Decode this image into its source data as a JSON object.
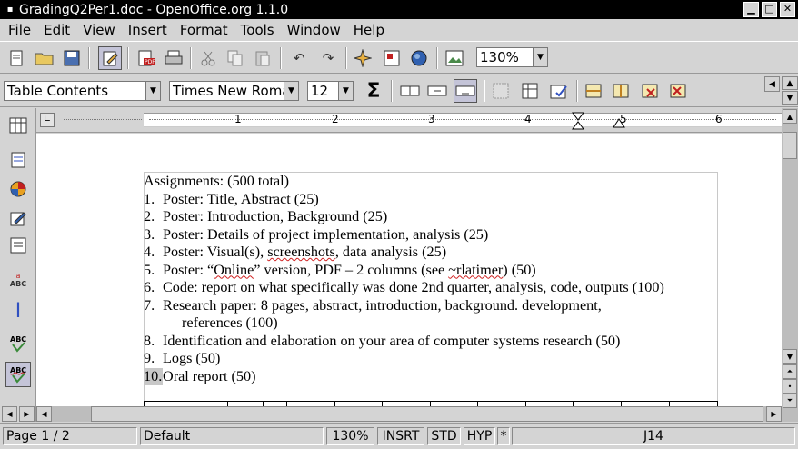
{
  "window": {
    "title": "GradingQ2Per1.doc - OpenOffice.org 1.1.0",
    "buttons": {
      "minimize": "▁",
      "maximize": "□",
      "close": "✕"
    }
  },
  "menu": [
    "File",
    "Edit",
    "View",
    "Insert",
    "Format",
    "Tools",
    "Window",
    "Help"
  ],
  "toolbar": {
    "zoom": "130%",
    "paragraph_style": "Table Contents",
    "font_name": "Times New Roma",
    "font_size": "12",
    "sum_symbol": "Σ"
  },
  "ruler": {
    "numbers": [
      "1",
      "2",
      "3",
      "4",
      "5",
      "6"
    ]
  },
  "document": {
    "heading": "Assignments: (500 total)",
    "items": [
      {
        "num": "1.",
        "text": "Poster: Title, Abstract (25)"
      },
      {
        "num": "2.",
        "text": "Poster: Introduction, Background (25)"
      },
      {
        "num": "3.",
        "text": "Poster: Details of project implementation, analysis (25)"
      },
      {
        "num": "4.",
        "pre": "Poster: Visual(s), ",
        "wavy": "screenshots",
        "post": ", data analysis (25)"
      },
      {
        "num": "5.",
        "pre": "Poster: “",
        "wavy": "Online",
        "post": "” version, PDF – 2 columns (see ",
        "wavy2": "~rlatimer",
        "post2": ") (50)"
      },
      {
        "num": "6.",
        "text": "Code: report on what specifically was done 2nd quarter, analysis, code, outputs (100)"
      },
      {
        "num": "7.",
        "text": "Research paper: 8 pages, abstract, introduction, background. development,",
        "cont": "references (100)"
      },
      {
        "num": "8.",
        "text": "Identification and elaboration on your area of computer systems research (50)"
      },
      {
        "num": "9.",
        "text": "Logs (50)"
      },
      {
        "num": "10.",
        "text": "Oral report (50)"
      }
    ]
  },
  "status": {
    "page": "Page 1 / 2",
    "style": "Default",
    "zoom": "130%",
    "insert_mode": "INSRT",
    "selection_mode": "STD",
    "hyperlink_mode": "HYP",
    "modified": "*",
    "cell": "J14"
  }
}
